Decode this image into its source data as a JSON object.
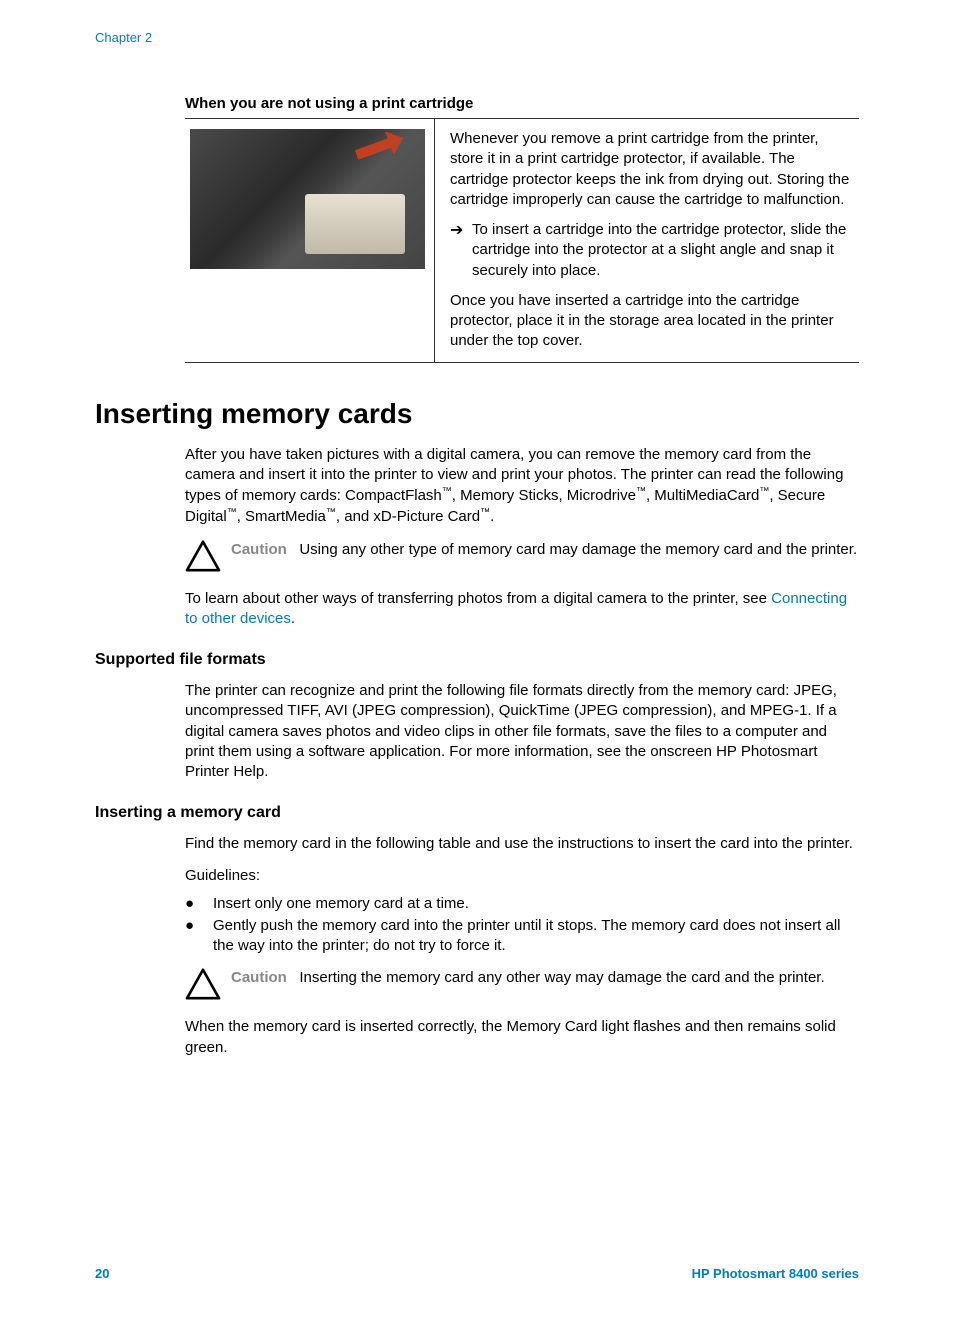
{
  "chapter": "Chapter 2",
  "table": {
    "title": "When you are not using a print cartridge",
    "para1": "Whenever you remove a print cartridge from the printer, store it in a print cartridge protector, if available. The cartridge protector keeps the ink from drying out. Storing the cartridge improperly can cause the cartridge to malfunction.",
    "arrow_item": "To insert a cartridge into the cartridge protector, slide the cartridge into the protector at a slight angle and snap it securely into place.",
    "para2": "Once you have inserted a cartridge into the cartridge protector, place it in the storage area located in the printer under the top cover."
  },
  "heading_main": "Inserting memory cards",
  "intro_para_prefix": "After you have taken pictures with a digital camera, you can remove the memory card from the camera and insert it into the printer to view and print your photos. The printer can read the following types of memory cards: CompactFlash",
  "intro_mid1": ", Memory Sticks, Microdrive",
  "intro_mid2": ", MultiMediaCard",
  "intro_mid3": ", Secure Digital",
  "intro_mid4": ", SmartMedia",
  "intro_mid5": ", and xD-Picture Card",
  "intro_end": ".",
  "caution1": {
    "label": "Caution",
    "text": "Using any other type of memory card may damage the memory card and the printer."
  },
  "learn_prefix": "To learn about other ways of transferring photos from a digital camera to the printer, see ",
  "learn_link": "Connecting to other devices",
  "learn_suffix": ".",
  "sub1": {
    "heading": "Supported file formats",
    "para": "The printer can recognize and print the following file formats directly from the memory card: JPEG, uncompressed TIFF, AVI (JPEG compression), QuickTime (JPEG compression), and MPEG-1. If a digital camera saves photos and video clips in other file formats, save the files to a computer and print them using a software application. For more information, see the onscreen HP Photosmart Printer Help."
  },
  "sub2": {
    "heading": "Inserting a memory card",
    "para": "Find the memory card in the following table and use the instructions to insert the card into the printer.",
    "guidelines": "Guidelines:",
    "bullet1": "Insert only one memory card at a time.",
    "bullet2": "Gently push the memory card into the printer until it stops. The memory card does not insert all the way into the printer; do not try to force it."
  },
  "caution2": {
    "label": "Caution",
    "text": "Inserting the memory card any other way may damage the card and the printer."
  },
  "closing_para": "When the memory card is inserted correctly, the Memory Card light flashes and then remains solid green.",
  "footer": {
    "page": "20",
    "product": "HP Photosmart 8400 series"
  }
}
